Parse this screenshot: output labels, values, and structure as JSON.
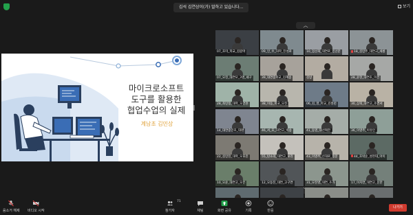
{
  "topbar": {
    "banner_text": "김석 김연상이(가) 말하고 있습니다...",
    "view_label": "보기",
    "shield_color": "#23a04b"
  },
  "slide": {
    "title_lines": [
      "마이크로소프트",
      "도구를 활용한",
      "협업수업의 실제"
    ],
    "author": "계남초 김민상",
    "accent_color": "#e0a23a",
    "illustration_color": "#3a6db5"
  },
  "gallery": {
    "up_arrow": "︿",
    "down_arrow": "﹀",
    "tiles": [
      {
        "name": "07_호미_학교_김갈마",
        "color": "#3b3f44",
        "muted": false
      },
      {
        "name": "09_인_수_대학_진성로",
        "color": "#7f8a8f",
        "muted": false
      },
      {
        "name": "10_엄선희_대연로_민선문",
        "color": "#9a9ea3",
        "muted": false
      },
      {
        "name": "18_김민주_대연고_세룡",
        "color": "#8c9396",
        "muted": true
      },
      {
        "name": "07_오진_대연모_3명_세구",
        "color": "#6c7d74",
        "muted": false
      },
      {
        "name": "39_대연중학교_김혜송",
        "color": "#a7a29b",
        "muted": false
      },
      {
        "name": "김방",
        "color": "#b3aca2",
        "muted": false
      },
      {
        "name": "28_윤현_대연초_이은",
        "color": "#a6a8a6",
        "muted": false
      },
      {
        "name": "28_최민정_대학_오건현",
        "color": "#9fb3a8",
        "muted": false
      },
      {
        "name": "38_이동_학교_오진",
        "color": "#b8b6ad",
        "muted": false
      },
      {
        "name": "06_김_영_학교_김홍련",
        "color": "#6e7b88",
        "muted": false
      },
      {
        "name": "30_상희_대연고_조연서",
        "color": "#b9b2a5",
        "muted": false
      },
      {
        "name": "14_대연중앙초_대판",
        "color": "#7f8590",
        "muted": false
      },
      {
        "name": "46_서_호_대연고_박송",
        "color": "#a7b6b0",
        "muted": false
      },
      {
        "name": "41_동영_대선택한",
        "color": "#a5ada8",
        "muted": false
      },
      {
        "name": "36_이영주_이유인",
        "color": "#8e9f98",
        "muted": false
      },
      {
        "name": "22_김민진_대학_오호진",
        "color": "#7d7a73",
        "muted": false
      },
      {
        "name": "55_탄소의_대연고_보라",
        "color": "#c4c1bb",
        "muted": false
      },
      {
        "name": "43_이영주_신대로_정문",
        "color": "#b7b3aa",
        "muted": false
      },
      {
        "name": "44_호박순_성현대_아이",
        "color": "#5c6a64",
        "muted": true
      },
      {
        "name": "10_오윤_대연고_오은",
        "color": "#6a7e6a",
        "muted": false
      },
      {
        "name": "12_오동진_대연_고구연",
        "color": "#515558",
        "muted": false
      },
      {
        "name": "31_오진영_대연_초가",
        "color": "#8c968e",
        "muted": false
      },
      {
        "name": "17_이지연_대연고_신한",
        "color": "#74807a",
        "muted": false
      },
      {
        "name": "09_조명희_대인원_필에",
        "color": "#5f6b70",
        "muted": false
      },
      {
        "name": "05_한_윤_대연중_시민",
        "color": "#3e4246",
        "muted": false
      },
      {
        "name": "11_이영희_대연고_고현",
        "color": "#8b8e89",
        "muted": false
      },
      {
        "name": "최준희_신연주_대민",
        "color": "#6a6e6f",
        "muted": false
      }
    ]
  },
  "toolbar": {
    "mute_label": "음소거 해제",
    "video_label": "비디오 시작",
    "participants_label": "참가자",
    "participants_count": "71",
    "chat_label": "채팅",
    "share_label": "화면 공유",
    "record_label": "기록",
    "reactions_label": "반응",
    "end_label": "나가기",
    "share_color": "#23a04b",
    "end_color": "#d13b2f"
  }
}
